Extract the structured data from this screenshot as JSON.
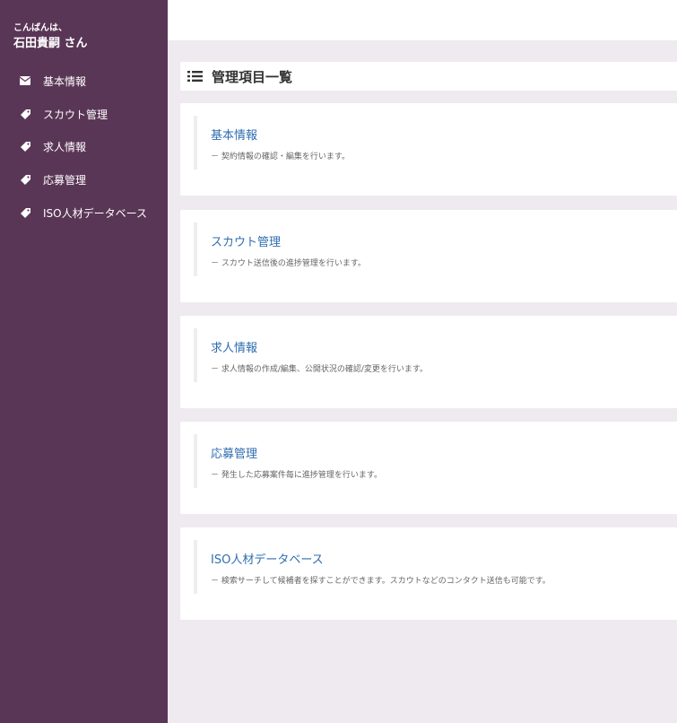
{
  "sidebar": {
    "greeting": "こんばんは、",
    "username": "石田貴嗣 さん",
    "items": [
      {
        "label": "基本情報",
        "icon": "envelope-icon"
      },
      {
        "label": "スカウト管理",
        "icon": "tag-icon"
      },
      {
        "label": "求人情報",
        "icon": "tag-icon"
      },
      {
        "label": "応募管理",
        "icon": "tag-icon"
      },
      {
        "label": "ISO人材データベース",
        "icon": "tag-icon"
      }
    ]
  },
  "main": {
    "header": {
      "title": "管理項目一覧",
      "icon": "list-icon"
    },
    "cards": [
      {
        "title": "基本情報",
        "desc": "－ 契約情報の確認・編集を行います。"
      },
      {
        "title": "スカウト管理",
        "desc": "－ スカウト送信後の進捗管理を行います。"
      },
      {
        "title": "求人情報",
        "desc": "－ 求人情報の作成/編集、公開状況の確認/変更を行います。"
      },
      {
        "title": "応募管理",
        "desc": "－ 発生した応募案件毎に進捗管理を行います。"
      },
      {
        "title": "ISO人材データベース",
        "desc": "－ 検索サーチして候補者を探すことができます。スカウトなどのコンタクト送信も可能です。"
      }
    ]
  },
  "colors": {
    "sidebar_bg": "#5a3656",
    "page_bg": "#efeaef",
    "link": "#2f6db0"
  }
}
